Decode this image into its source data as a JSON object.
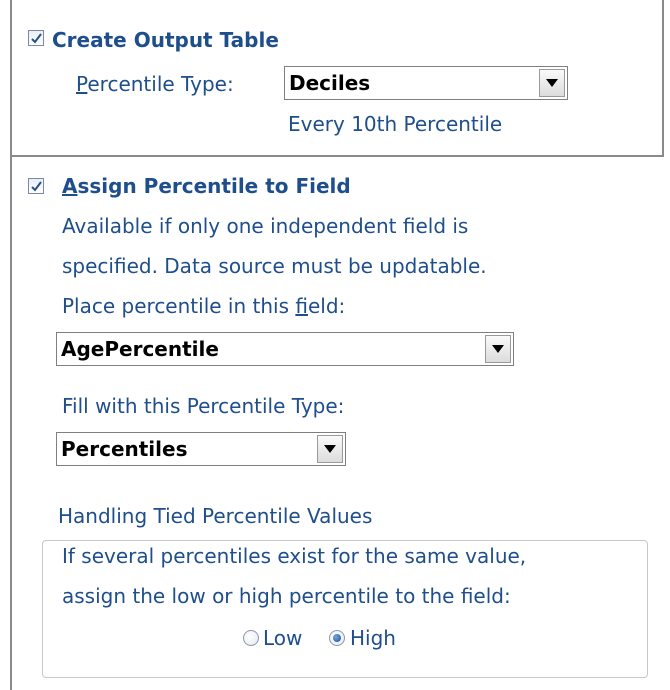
{
  "output_table": {
    "checkbox_checked": true,
    "label_prefix": "Create ",
    "label_rest": "Output Table",
    "percentile_type_label": "Percentile Type:",
    "percentile_type_value": "Deciles",
    "percentile_type_hint": "Every 10th Percentile"
  },
  "assign_field": {
    "checkbox_checked": true,
    "label": "Assign Percentile to Field",
    "desc_line1": "Available if only one independent field is",
    "desc_line2": "specified. Data source must be updatable.",
    "field_label_prefix": "Place percentile in this ",
    "field_label_underlined": "f",
    "field_label_suffix": "ield:",
    "field_value": "AgePercentile",
    "fill_type_label": "Fill with this Percentile Type:",
    "fill_type_value": "Percentiles"
  },
  "ties": {
    "legend": "Handling Tied Percentile Values",
    "desc_line1": "If several percentiles exist for the same value,",
    "desc_line2": "assign the low or high percentile to the field:",
    "option_low": "Low",
    "option_high": "High",
    "selected": "High"
  }
}
